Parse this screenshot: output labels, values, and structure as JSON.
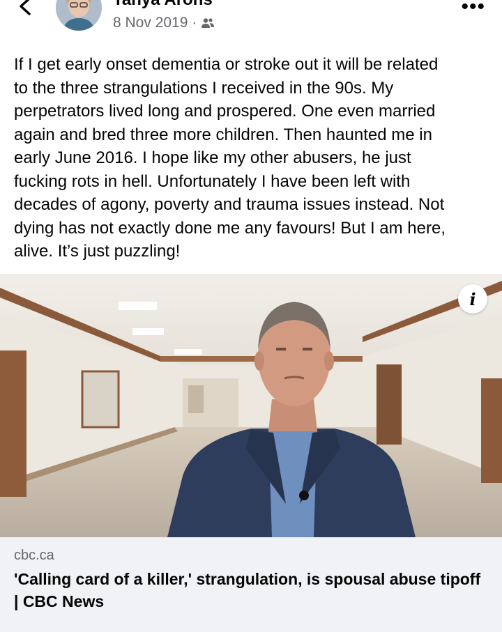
{
  "post": {
    "author": "Tanya Arons",
    "date": "8 Nov 2019",
    "separator": "·",
    "audience_icon": "friends-icon",
    "more_label": "•••",
    "text": "If I get early onset dementia or stroke out it will be related\nto the three strangulations I received in the 90s.  My\nperpetrators lived long and prospered.  One even married\nagain and bred three more children.  Then haunted me in\nearly June 2016.  I hope like my other abusers, he just\nfucking rots in hell.  Unfortunately I have been left with\ndecades of agony, poverty and trauma issues instead.  Not\ndying has not exactly done me any favours!  But I am here,\nalive. It’s just puzzling!"
  },
  "link": {
    "domain": "cbc.ca",
    "title": "'Calling card of a killer,' strangulation, is spousal abuse tipoff | CBC News",
    "info_label": "i"
  },
  "colors": {
    "text": "#050505",
    "secondary": "#65676b",
    "card_bg": "#f0f2f5"
  }
}
